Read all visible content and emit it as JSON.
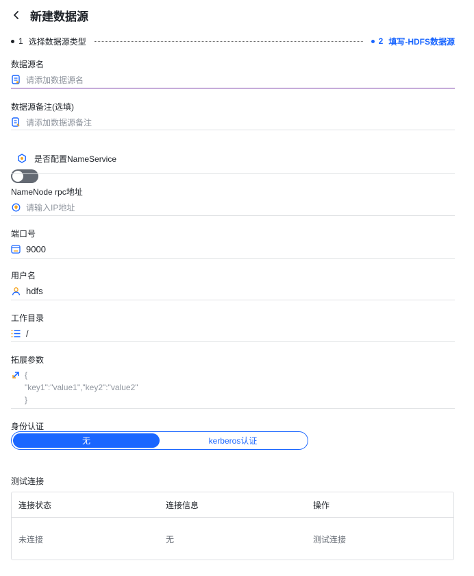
{
  "header": {
    "title": "新建数据源"
  },
  "steps": [
    {
      "num": "1",
      "label": "选择数据源类型"
    },
    {
      "num": "2",
      "label": "填写-HDFS数据源"
    }
  ],
  "fields": {
    "name": {
      "label": "数据源名",
      "placeholder": "请添加数据源名"
    },
    "remark": {
      "label": "数据源备注(选填)",
      "placeholder": "请添加数据源备注"
    },
    "nameservice": {
      "label": "是否配置NameService",
      "enabled": false
    },
    "namenode": {
      "label": "NameNode rpc地址",
      "placeholder": "请输入IP地址"
    },
    "port": {
      "label": "端口号",
      "value": "9000"
    },
    "username": {
      "label": "用户名",
      "value": "hdfs"
    },
    "workdir": {
      "label": "工作目录",
      "value": "/"
    },
    "params": {
      "label": "拓展参数",
      "lines": [
        "{",
        "\"key1\":\"value1\",\"key2\":\"value2\"",
        "}"
      ]
    },
    "auth": {
      "label": "身份认证",
      "options": [
        "无",
        "kerberos认证"
      ],
      "selected": "无"
    }
  },
  "test": {
    "label": "测试连接",
    "columns": [
      "连接状态",
      "连接信息",
      "操作"
    ],
    "rows": [
      [
        "未连接",
        "无",
        "测试连接"
      ]
    ]
  },
  "colors": {
    "accent": "#1a66ff",
    "focus_underline": "#7a3ea8",
    "toggle_off": "#646a73",
    "icon_orange": "#f5a623"
  }
}
